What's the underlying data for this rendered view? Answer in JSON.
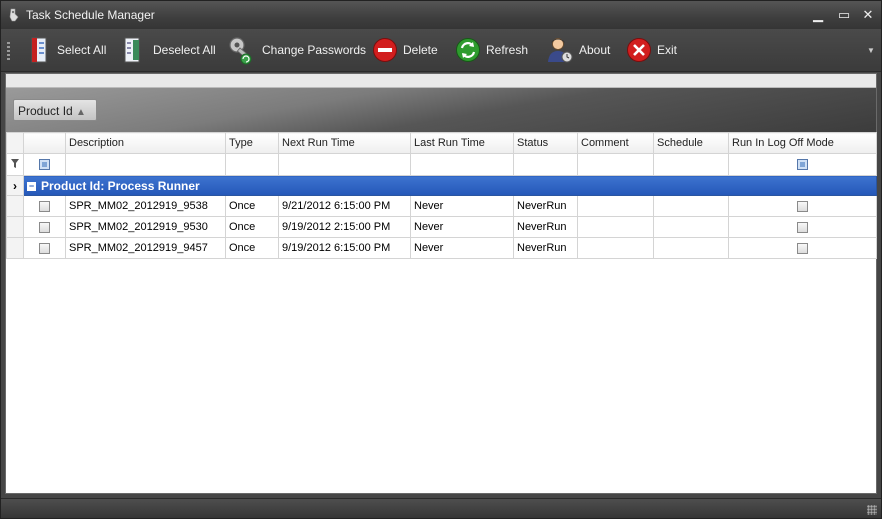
{
  "window": {
    "title": "Task Schedule Manager"
  },
  "toolbar": {
    "items": [
      {
        "label": "Select All",
        "icon": "select-all-icon"
      },
      {
        "label": "Deselect All",
        "icon": "deselect-all-icon"
      },
      {
        "label": "Change Passwords",
        "icon": "key-icon"
      },
      {
        "label": "Delete",
        "icon": "delete-icon"
      },
      {
        "label": "Refresh",
        "icon": "refresh-icon"
      },
      {
        "label": "About",
        "icon": "about-user-icon"
      },
      {
        "label": "Exit",
        "icon": "exit-icon"
      }
    ]
  },
  "grouping": {
    "chip_label": "Product Id",
    "sort_glyph": "▲"
  },
  "grid": {
    "columns": [
      "Description",
      "Type",
      "Next Run Time",
      "Last Run Time",
      "Status",
      "Comment",
      "Schedule",
      "Run In Log Off Mode"
    ],
    "group_label": "Product Id: Process Runner",
    "rows": [
      {
        "description": "SPR_MM02_2012919_9538",
        "type": "Once",
        "next_run": "9/21/2012 6:15:00 PM",
        "last_run": "Never",
        "status": "NeverRun",
        "comment": "",
        "schedule": ""
      },
      {
        "description": "SPR_MM02_2012919_9530",
        "type": "Once",
        "next_run": "9/19/2012 2:15:00 PM",
        "last_run": "Never",
        "status": "NeverRun",
        "comment": "",
        "schedule": ""
      },
      {
        "description": "SPR_MM02_2012919_9457",
        "type": "Once",
        "next_run": "9/19/2012 6:15:00 PM",
        "last_run": "Never",
        "status": "NeverRun",
        "comment": "",
        "schedule": ""
      }
    ]
  },
  "colors": {
    "group_row": "#2457b8",
    "chrome": "#3e3e3e",
    "delete": "#d21e1e",
    "refresh": "#2e9b2e",
    "exit": "#d21e1e"
  }
}
